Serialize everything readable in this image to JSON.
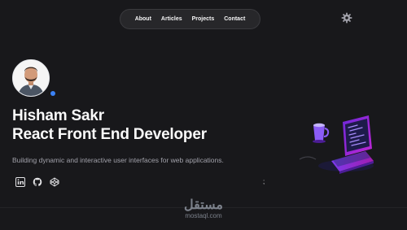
{
  "nav": {
    "items": [
      {
        "label": "About"
      },
      {
        "label": "Articles"
      },
      {
        "label": "Projects"
      },
      {
        "label": "Contact"
      }
    ]
  },
  "header": {
    "theme_toggle_icon": "gear-icon"
  },
  "hero": {
    "name": "Hisham Sakr",
    "role": "React Front End Developer",
    "tagline": "Building dynamic and interactive user interfaces for web applications.",
    "status_color": "#3b82f6",
    "socials": [
      {
        "icon": "linkedin-icon"
      },
      {
        "icon": "github-icon"
      },
      {
        "icon": "codepen-icon"
      }
    ],
    "stray_text": ";"
  },
  "watermark": {
    "arabic": "مستقل",
    "latin": "mostaql.com"
  },
  "colors": {
    "background": "#18181b",
    "nav_bg": "#27272a",
    "accent": "#3b82f6",
    "text": "#fafafa",
    "muted": "#a1a1aa"
  }
}
